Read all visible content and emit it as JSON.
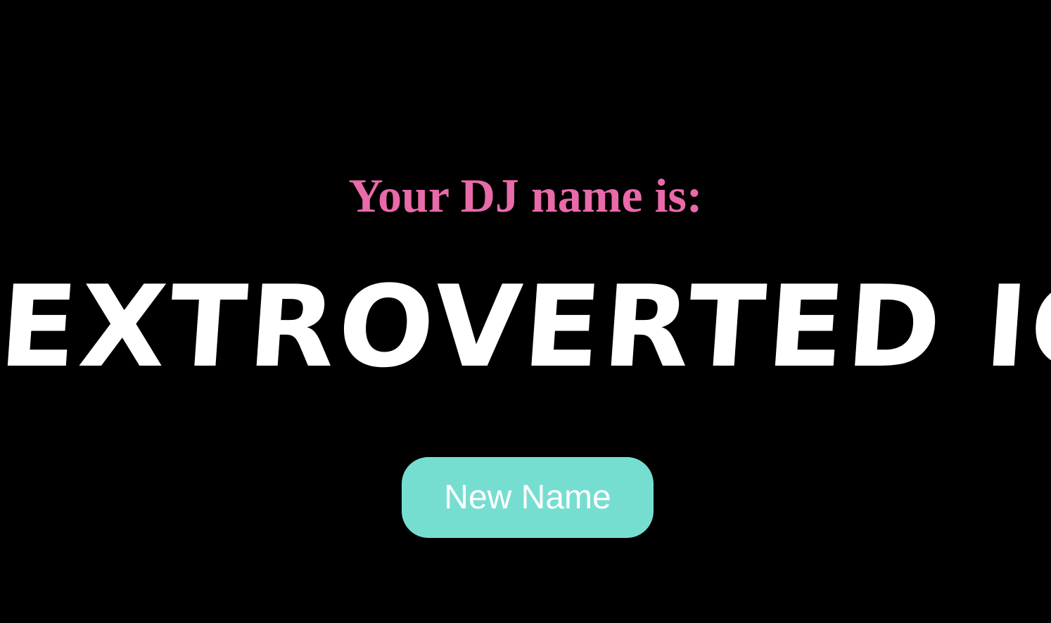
{
  "heading": {
    "text": "Your DJ name is:",
    "color": "#e96aa9"
  },
  "dj_name": {
    "text": "EXTROVERTED ICE",
    "color": "#ffffff"
  },
  "button": {
    "label": "New Name",
    "background": "#76ded1"
  },
  "page": {
    "background": "#000000"
  }
}
